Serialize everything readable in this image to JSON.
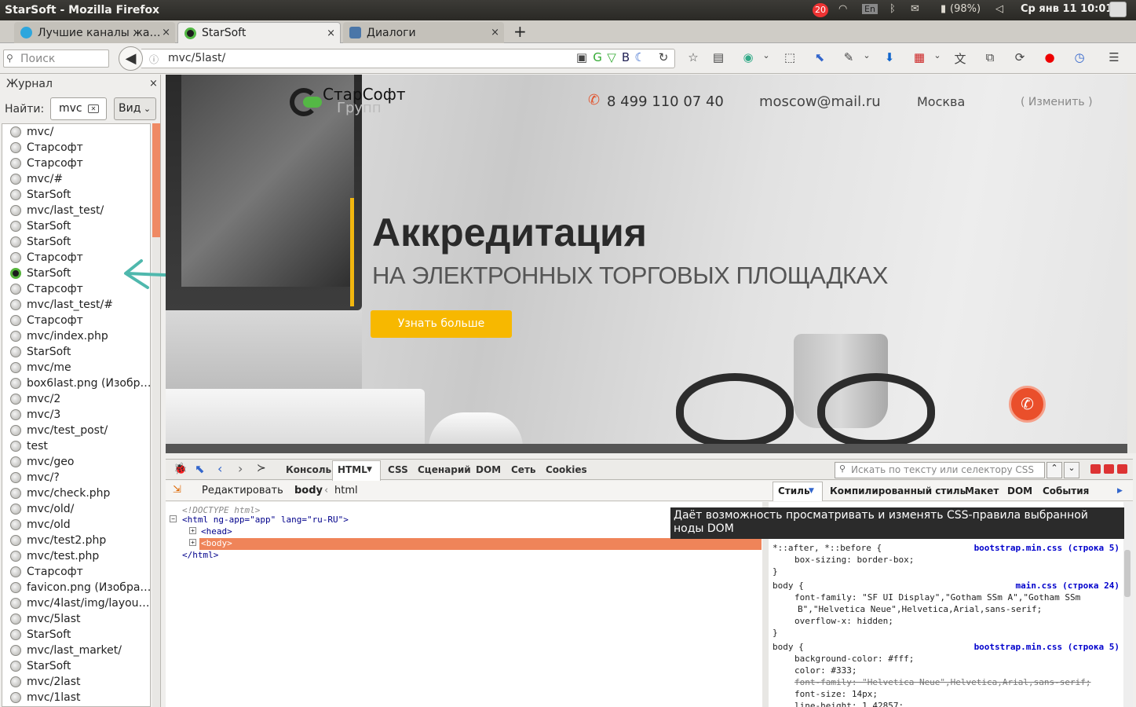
{
  "window_title": "StarSoft - Mozilla Firefox",
  "tray": {
    "notif_count": "20",
    "lang": "En",
    "battery": "(98%)",
    "clock": "Ср янв 11 10:01"
  },
  "tabs": [
    {
      "label": "Лучшие каналы жа…",
      "color": "#2ea6dd"
    },
    {
      "label": "StarSoft",
      "color": "#54b845"
    },
    {
      "label": "Диалоги",
      "color": "#4a76a8"
    }
  ],
  "tab_close": "×",
  "new_tab": "+",
  "search_placeholder": "Поиск",
  "url": "mvc/5last/",
  "sidebar": {
    "title": "Журнал",
    "close": "×",
    "find_label": "Найти:",
    "find_value": "mvc",
    "view_label": "Вид",
    "items": [
      "mvc/",
      "Старсофт",
      "Старсофт",
      "mvc/#",
      "StarSoft",
      "mvc/last_test/",
      "StarSoft",
      "StarSoft",
      "Старсофт",
      "StarSoft",
      "Старсофт",
      "mvc/last_test/#",
      "Старсофт",
      "mvc/index.php",
      "StarSoft",
      "mvc/me",
      "box6last.png (Изобр…",
      "mvc/2",
      "mvc/3",
      "mvc/test_post/",
      "test",
      "mvc/geo",
      "mvc/?",
      "mvc/check.php",
      "mvc/old/",
      "mvc/old",
      "mvc/test2.php",
      "mvc/test.php",
      "Старсофт",
      "favicon.png (Изобра…",
      "mvc/4last/img/layou…",
      "mvc/5last",
      "StarSoft",
      "mvc/last_market/",
      "StarSoft",
      "mvc/2last",
      "mvc/1last"
    ],
    "selected_index": 9
  },
  "site": {
    "logo_title": "СтарСофт",
    "logo_sub": "Групп",
    "phone": "8 499 110 07 40",
    "email": "moscow@mail.ru",
    "city": "Москва",
    "change": "( Изменить )",
    "headline": "Аккредитация",
    "subheadline": "НА ЭЛЕКТРОННЫХ ТОРГОВЫХ ПЛОЩАДКАХ",
    "cta": "Узнать больше"
  },
  "firebug": {
    "tabs": [
      "Консоль",
      "HTML",
      "CSS",
      "Сценарий",
      "DOM",
      "Сеть",
      "Cookies"
    ],
    "search_placeholder": "Искать по тексту или селектору CSS",
    "edit": "Редактировать",
    "crumb_body": "body",
    "crumb_html": "html",
    "side_tabs": [
      "Стиль",
      "Компилированный стиль",
      "Макет",
      "DOM",
      "События"
    ],
    "html_lines": [
      "<!DOCTYPE html>",
      "<html ng-app=\"app\" lang=\"ru-RU\">",
      "<head>",
      "<body>",
      "</html>"
    ],
    "tooltip": "Даёт возможность просматривать и изменять CSS-правила выбранной ноды DOM",
    "rules": [
      {
        "selector": "*::after, *::before {",
        "source": "bootstrap.min.css (строка 5)",
        "props": [
          "box-sizing: border-box;"
        ]
      },
      {
        "selector": "body {",
        "source": "main.css (строка 24)",
        "props": [
          "font-family: \"SF UI Display\",\"Gotham SSm A\",\"Gotham SSm",
          "B\",\"Helvetica Neue\",Helvetica,Arial,sans-serif;",
          "overflow-x: hidden;"
        ]
      },
      {
        "selector": "body {",
        "source": "bootstrap.min.css (строка 5)",
        "props": [
          "background-color: #fff;",
          "color: #333;",
          "font-family: \"Helvetica Neue\",Helvetica,Arial,sans-serif;",
          "font-size: 14px;",
          "line-height: 1.42857;"
        ]
      }
    ],
    "close_brace": "}"
  }
}
